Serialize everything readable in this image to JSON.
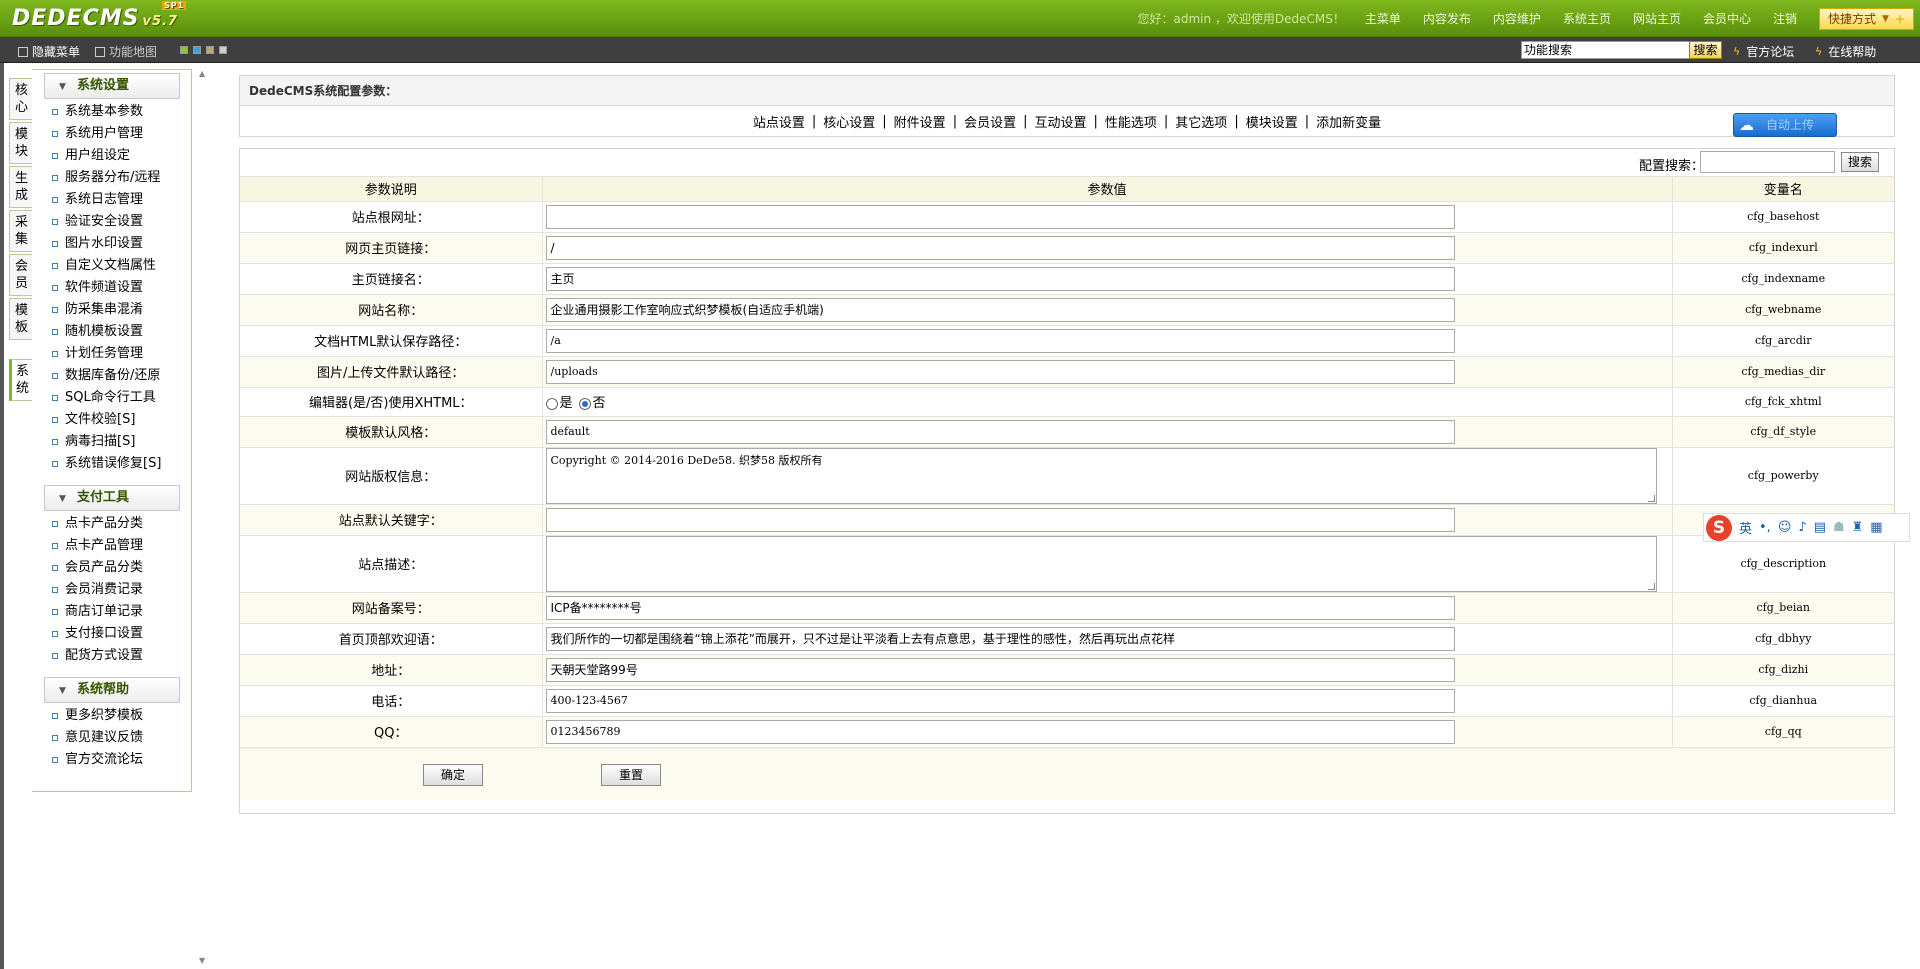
{
  "header": {
    "logo": "DEDECMS",
    "logo_version": "v5.7",
    "logo_badge": "SP1",
    "welcome": "您好：admin ，欢迎使用DedeCMS！",
    "nav": [
      "主菜单",
      "内容发布",
      "内容维护",
      "系统主页",
      "网站主页",
      "会员中心",
      "注销"
    ],
    "quick": "快捷方式",
    "quick_extra": "+"
  },
  "toolbar": {
    "hide_menu": "隐藏菜单",
    "func_map": "功能地图",
    "swatches": [
      "#8fc23a",
      "#43a0d8",
      "#b8a878",
      "#cfcfcf"
    ],
    "search_value": "功能搜索",
    "search_btn": "搜索",
    "forum": "官方论坛",
    "help": "在线帮助"
  },
  "vtabs": [
    {
      "label": "核心",
      "active": false
    },
    {
      "label": "模块",
      "active": false
    },
    {
      "label": "生成",
      "active": false
    },
    {
      "label": "采集",
      "active": false
    },
    {
      "label": "会员",
      "active": false
    },
    {
      "label": "模板",
      "active": false
    },
    {
      "label": "系统",
      "active": true
    }
  ],
  "menu": [
    {
      "title": "系统设置",
      "items": [
        "系统基本参数",
        "系统用户管理",
        "用户组设定",
        "服务器分布/远程",
        "系统日志管理",
        "验证安全设置",
        "图片水印设置",
        "自定义文档属性",
        "软件频道设置",
        "防采集串混淆",
        "随机模板设置",
        "计划任务管理",
        "数据库备份/还原",
        "SQL命令行工具",
        "文件校验[S]",
        "病毒扫描[S]",
        "系统错误修复[S]"
      ]
    },
    {
      "title": "支付工具",
      "items": [
        "点卡产品分类",
        "点卡产品管理",
        "会员产品分类",
        "会员消费记录",
        "商店订单记录",
        "支付接口设置",
        "配货方式设置"
      ]
    },
    {
      "title": "系统帮助",
      "items": [
        "更多织梦模板",
        "意见建议反馈",
        "官方交流论坛"
      ]
    }
  ],
  "panel": {
    "title": "DedeCMS系统配置参数：",
    "tabs": [
      "站点设置",
      "核心设置",
      "附件设置",
      "会员设置",
      "互动设置",
      "性能选项",
      "其它选项",
      "模块设置",
      "添加新变量"
    ],
    "update_btn": "自动上传",
    "search_label": "配置搜索：",
    "search_btn": "搜索"
  },
  "table": {
    "headers": [
      "参数说明",
      "参数值",
      "变量名"
    ],
    "rows": [
      {
        "label": "站点根网址：",
        "type": "input",
        "value": "",
        "var": "cfg_basehost",
        "mono": false
      },
      {
        "label": "网页主页链接：",
        "type": "input",
        "value": "/",
        "var": "cfg_indexurl",
        "mono": false
      },
      {
        "label": "主页链接名：",
        "type": "input",
        "value": "主页",
        "var": "cfg_indexname",
        "mono": false
      },
      {
        "label": "网站名称：",
        "type": "input",
        "value": "企业通用摄影工作室响应式织梦模板(自适应手机端)",
        "var": "cfg_webname",
        "mono": false
      },
      {
        "label": "文档HTML默认保存路径：",
        "type": "input",
        "value": "/a",
        "var": "cfg_arcdir",
        "mono": true
      },
      {
        "label": "图片/上传文件默认路径：",
        "type": "input",
        "value": "/uploads",
        "var": "cfg_medias_dir",
        "mono": true
      },
      {
        "label": "编辑器(是/否)使用XHTML：",
        "type": "radio",
        "options": [
          "是",
          "否"
        ],
        "selected": 1,
        "var": "cfg_fck_xhtml"
      },
      {
        "label": "模板默认风格：",
        "type": "input",
        "value": "default",
        "var": "cfg_df_style",
        "mono": true
      },
      {
        "label": "网站版权信息：",
        "type": "textarea",
        "value": "Copyright © 2014-2016 DeDe58. 织梦58 版权所有",
        "var": "cfg_powerby"
      },
      {
        "label": "站点默认关键字：",
        "type": "input",
        "value": "",
        "var": "",
        "mono": false
      },
      {
        "label": "站点描述：",
        "type": "textarea",
        "value": "",
        "var": "cfg_description"
      },
      {
        "label": "网站备案号：",
        "type": "input",
        "value": "ICP备********号",
        "var": "cfg_beian",
        "mono": false
      },
      {
        "label": "首页顶部欢迎语：",
        "type": "input",
        "value": "我们所作的一切都是围绕着“锦上添花”而展开，只不过是让平淡看上去有点意思，基于理性的感性，然后再玩出点花样",
        "var": "cfg_dbhyy",
        "mono": false
      },
      {
        "label": "地址：",
        "type": "input",
        "value": "天朝天堂路99号",
        "var": "cfg_dizhi",
        "mono": false
      },
      {
        "label": "电话：",
        "type": "input",
        "value": "400-123-4567",
        "var": "cfg_dianhua",
        "mono": true
      },
      {
        "label": "QQ：",
        "type": "input",
        "value": "0123456789",
        "var": "cfg_qq",
        "mono": true
      }
    ],
    "submit_btn": "确定",
    "reset_btn": "重置"
  },
  "ime": {
    "logo": "S",
    "lang": "英",
    "icons": [
      "标点",
      "表情",
      "语音",
      "软键盘",
      "用户",
      "皮肤",
      "工具箱"
    ]
  }
}
